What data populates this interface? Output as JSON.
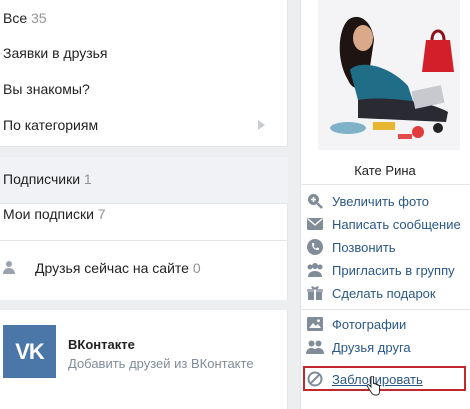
{
  "left": {
    "all": {
      "label": "Все",
      "count": "35"
    },
    "requests": "Заявки в друзья",
    "maybe_know": "Вы знакомы?",
    "by_category": "По категориям",
    "followers": {
      "label": "Подписчики",
      "count": "1"
    },
    "my_subscriptions": {
      "label": "Мои подписки",
      "count": "7"
    },
    "online": {
      "label": "Друзья сейчас на сайте",
      "count": "0"
    }
  },
  "vk": {
    "logo": "VK",
    "title": "ВКонтакте",
    "subtitle": "Добавить друзей из ВКонтакте"
  },
  "profile": {
    "name": "Кате Рина"
  },
  "menu": {
    "enlarge_photo": "Увеличить фото",
    "write_message": "Написать сообщение",
    "call": "Позвонить",
    "invite_group": "Пригласить в группу",
    "gift": "Сделать подарок",
    "photos": "Фотографии",
    "friends_of_friend": "Друзья друга",
    "block": "Заблокировать"
  },
  "colors": {
    "link": "#2a5885",
    "icon": "#818c99",
    "highlight_border": "#c0282d",
    "vk_blue": "#4a76a8"
  }
}
